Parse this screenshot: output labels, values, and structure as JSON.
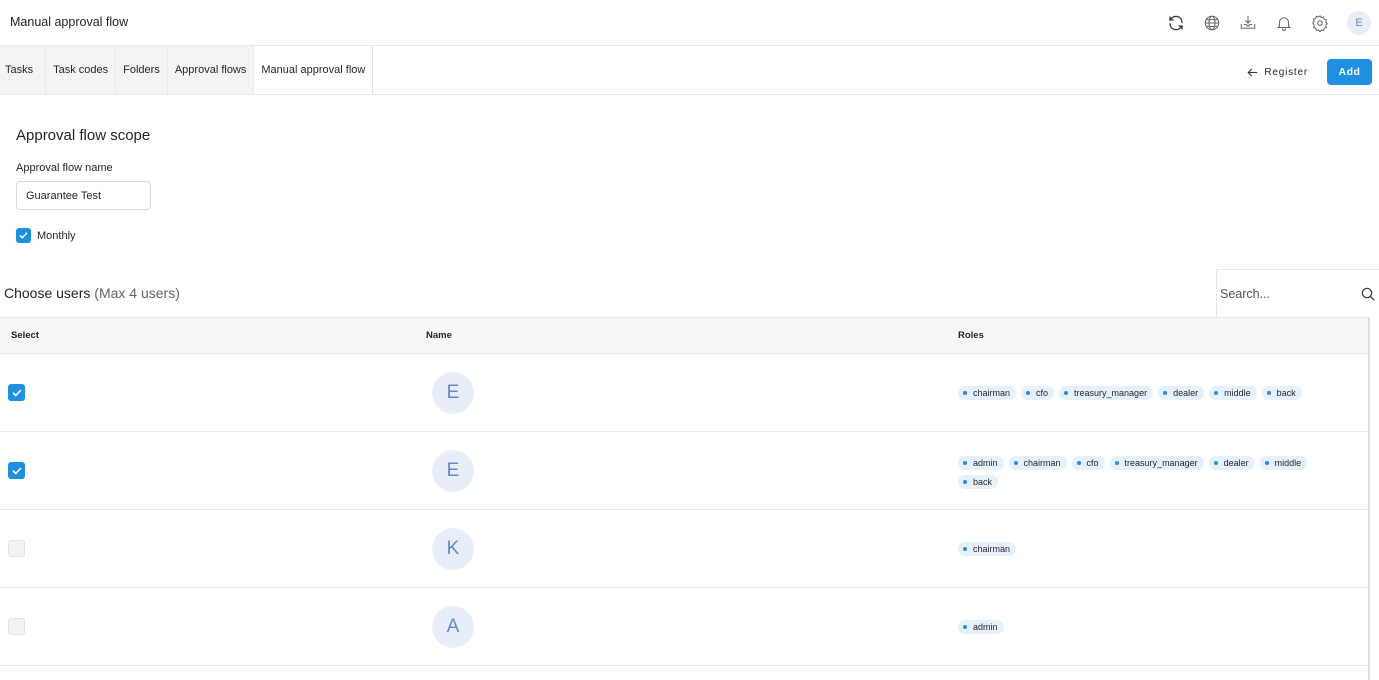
{
  "header": {
    "title": "Manual approval flow",
    "icons": [
      "refresh-icon",
      "globe-icon",
      "download-icon",
      "bell-icon",
      "gear-icon"
    ],
    "avatar_initial": "E"
  },
  "tabs": [
    {
      "label": "Tasks",
      "active": false
    },
    {
      "label": "Task codes",
      "active": false
    },
    {
      "label": "Folders",
      "active": false
    },
    {
      "label": "Approval flows",
      "active": false
    },
    {
      "label": "Manual approval flow",
      "active": true
    }
  ],
  "actions": {
    "register_label": "Register",
    "add_label": "Add"
  },
  "scope": {
    "title": "Approval flow scope",
    "name_label": "Approval flow name",
    "name_value": "Guarantee Test",
    "monthly_label": "Monthly",
    "monthly_checked": true
  },
  "users": {
    "title": "Choose users",
    "subtitle": "(Max 4 users)",
    "search_placeholder": "Search...",
    "columns": [
      "Select",
      "Name",
      "Roles"
    ],
    "rows": [
      {
        "selected": true,
        "initial": "E",
        "roles": [
          "chairman",
          "cfo",
          "treasury_manager",
          "dealer",
          "middle",
          "back"
        ]
      },
      {
        "selected": true,
        "initial": "E",
        "roles": [
          "admin",
          "chairman",
          "cfo",
          "treasury_manager",
          "dealer",
          "middle",
          "back"
        ]
      },
      {
        "selected": false,
        "initial": "K",
        "roles": [
          "chairman"
        ]
      },
      {
        "selected": false,
        "initial": "A",
        "roles": [
          "admin"
        ]
      }
    ]
  },
  "colors": {
    "accent": "#1f8fe0",
    "role_chip_bg": "#e6f1fb",
    "avatar_bg": "#e8eef9",
    "avatar_fg": "#6a86c7"
  }
}
